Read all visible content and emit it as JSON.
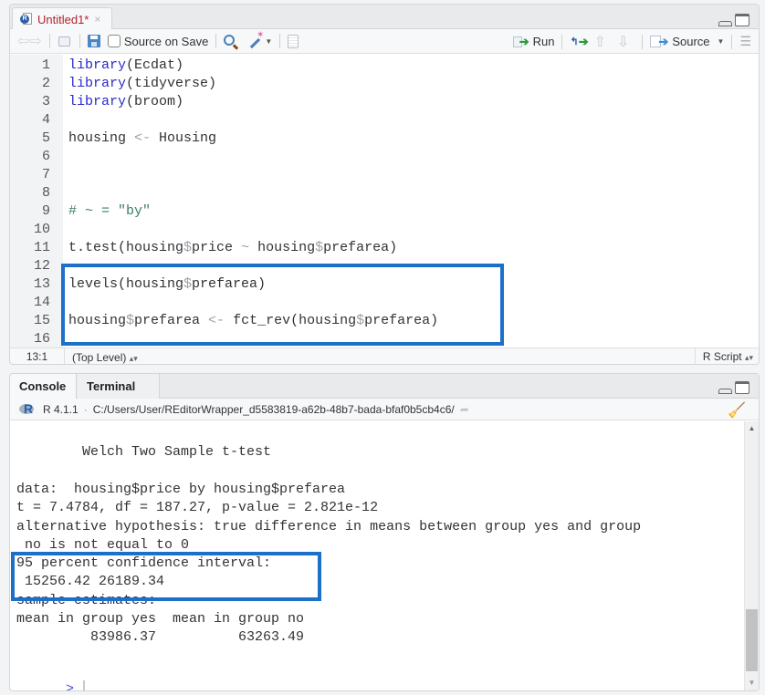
{
  "editor": {
    "tab": {
      "title": "Untitled1*",
      "close": "×",
      "icon": "r-script-file-icon"
    },
    "toolbar": {
      "source_on_save_label": "Source on Save",
      "source_on_save_checked": false,
      "run_label": "Run",
      "source_label": "Source"
    },
    "lines": [
      {
        "n": "1",
        "parts": [
          [
            "kw",
            "library"
          ],
          [
            "",
            "(Ecdat)"
          ]
        ]
      },
      {
        "n": "2",
        "parts": [
          [
            "kw",
            "library"
          ],
          [
            "",
            "(tidyverse)"
          ]
        ]
      },
      {
        "n": "3",
        "parts": [
          [
            "kw",
            "library"
          ],
          [
            "",
            "(broom)"
          ]
        ]
      },
      {
        "n": "4",
        "parts": []
      },
      {
        "n": "5",
        "parts": [
          [
            "",
            "housing "
          ],
          [
            "dim",
            "<-"
          ],
          [
            "",
            " Housing"
          ]
        ]
      },
      {
        "n": "6",
        "parts": []
      },
      {
        "n": "7",
        "parts": []
      },
      {
        "n": "8",
        "parts": []
      },
      {
        "n": "9",
        "parts": [
          [
            "cm",
            "# ~ = \"by\""
          ]
        ]
      },
      {
        "n": "10",
        "parts": []
      },
      {
        "n": "11",
        "parts": [
          [
            "",
            "t.test(housing"
          ],
          [
            "dim",
            "$"
          ],
          [
            "",
            "price "
          ],
          [
            "dim",
            "~"
          ],
          [
            "",
            " housing"
          ],
          [
            "dim",
            "$"
          ],
          [
            "",
            "prefarea)"
          ]
        ]
      },
      {
        "n": "12",
        "parts": []
      },
      {
        "n": "13",
        "parts": [
          [
            "",
            "levels(housing"
          ],
          [
            "dim",
            "$"
          ],
          [
            "",
            "prefarea)"
          ]
        ]
      },
      {
        "n": "14",
        "parts": []
      },
      {
        "n": "15",
        "parts": [
          [
            "",
            "housing"
          ],
          [
            "dim",
            "$"
          ],
          [
            "",
            "prefarea "
          ],
          [
            "dim",
            "<-"
          ],
          [
            "",
            " fct_rev(housing"
          ],
          [
            "dim",
            "$"
          ],
          [
            "",
            "prefarea)"
          ]
        ]
      },
      {
        "n": "16",
        "parts": []
      }
    ],
    "status": {
      "cursor_position": "13:1",
      "scope": "(Top Level)",
      "file_type": "R Script"
    },
    "highlight_color": "#1c70c8"
  },
  "console": {
    "tabs": [
      {
        "label": "Console",
        "active": true
      },
      {
        "label": "Terminal",
        "close": "×"
      }
    ],
    "r_version": "R 4.1.1",
    "separator": "·",
    "working_dir": "C:/Users/User/REditorWrapper_d5583819-a62b-48b7-bada-bfaf0b5cb4c6/",
    "output": [
      "",
      "        Welch Two Sample t-test",
      "",
      "data:  housing$price by housing$prefarea",
      "t = 7.4784, df = 187.27, p-value = 2.821e-12",
      "alternative hypothesis: true difference in means between group yes and group",
      " no is not equal to 0",
      "95 percent confidence interval:",
      " 15256.42 26189.34",
      "sample estimates:",
      "mean in group yes  mean in group no",
      "         83986.37          63263.49",
      ""
    ],
    "prompt": ">",
    "input_value": "",
    "scrollbar_position": 1.0
  }
}
